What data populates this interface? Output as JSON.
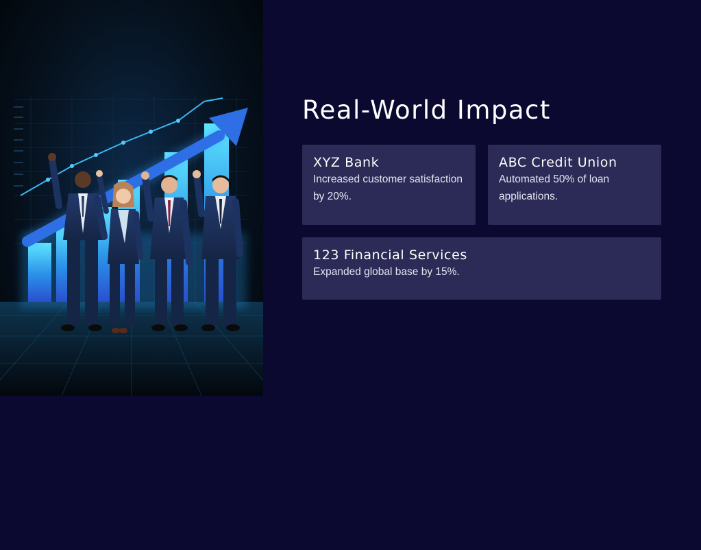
{
  "slide": {
    "title": "Real-World Impact"
  },
  "cards": [
    {
      "title": "XYZ Bank",
      "description": "Increased customer satisfaction by 20%."
    },
    {
      "title": "ABC Credit Union",
      "description": "Automated 50% of loan applications."
    },
    {
      "title": "123 Financial Services",
      "description": "Expanded global base by 15%."
    }
  ],
  "hero_image": {
    "subject": "Four business professionals celebrating in front of a glowing rising bar chart with an upward arrow",
    "icon": "growth-chart-celebration"
  },
  "colors": {
    "background": "#0c0930",
    "card_background": "#2c2a56",
    "title_text": "#ffffff",
    "body_text": "#e4e4f2",
    "chart_glow": "#3fd4ff",
    "arrow": "#2e6fe6",
    "suit": "#1b2f5a"
  }
}
